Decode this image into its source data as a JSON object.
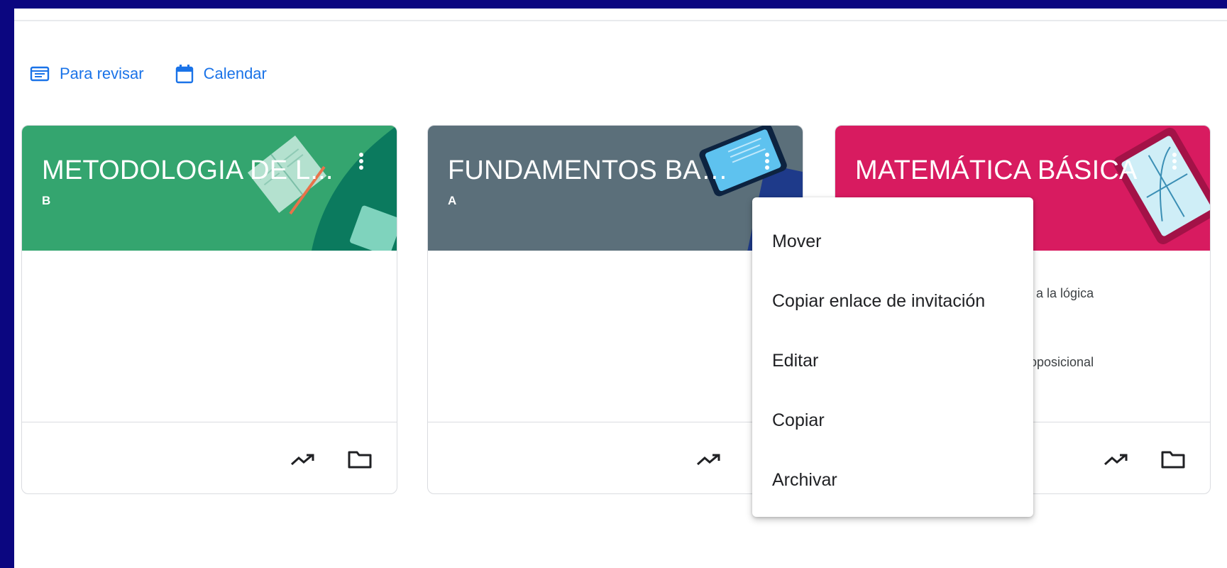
{
  "links": {
    "review": "Para revisar",
    "calendar": "Calendar"
  },
  "cards": [
    {
      "title": "METODOLOGIA DE L...",
      "section": "B",
      "color": "#34a56f"
    },
    {
      "title": "FUNDAMENTOS BASI...",
      "section": "A",
      "color": "#5b6f7a"
    },
    {
      "title": "MATEMÁTICA BÁSICA",
      "section": "",
      "color": "#d81b60",
      "upcoming": [
        "ón a la lógica",
        "proposicional"
      ]
    }
  ],
  "menu": {
    "items": [
      "Mover",
      "Copiar enlace de invitación",
      "Editar",
      "Copiar",
      "Archivar"
    ]
  },
  "icons": {
    "review": "assignment-folder-icon",
    "calendar": "calendar-icon",
    "more": "more-vert-icon",
    "trending": "trending-up-icon",
    "folder": "folder-icon"
  }
}
